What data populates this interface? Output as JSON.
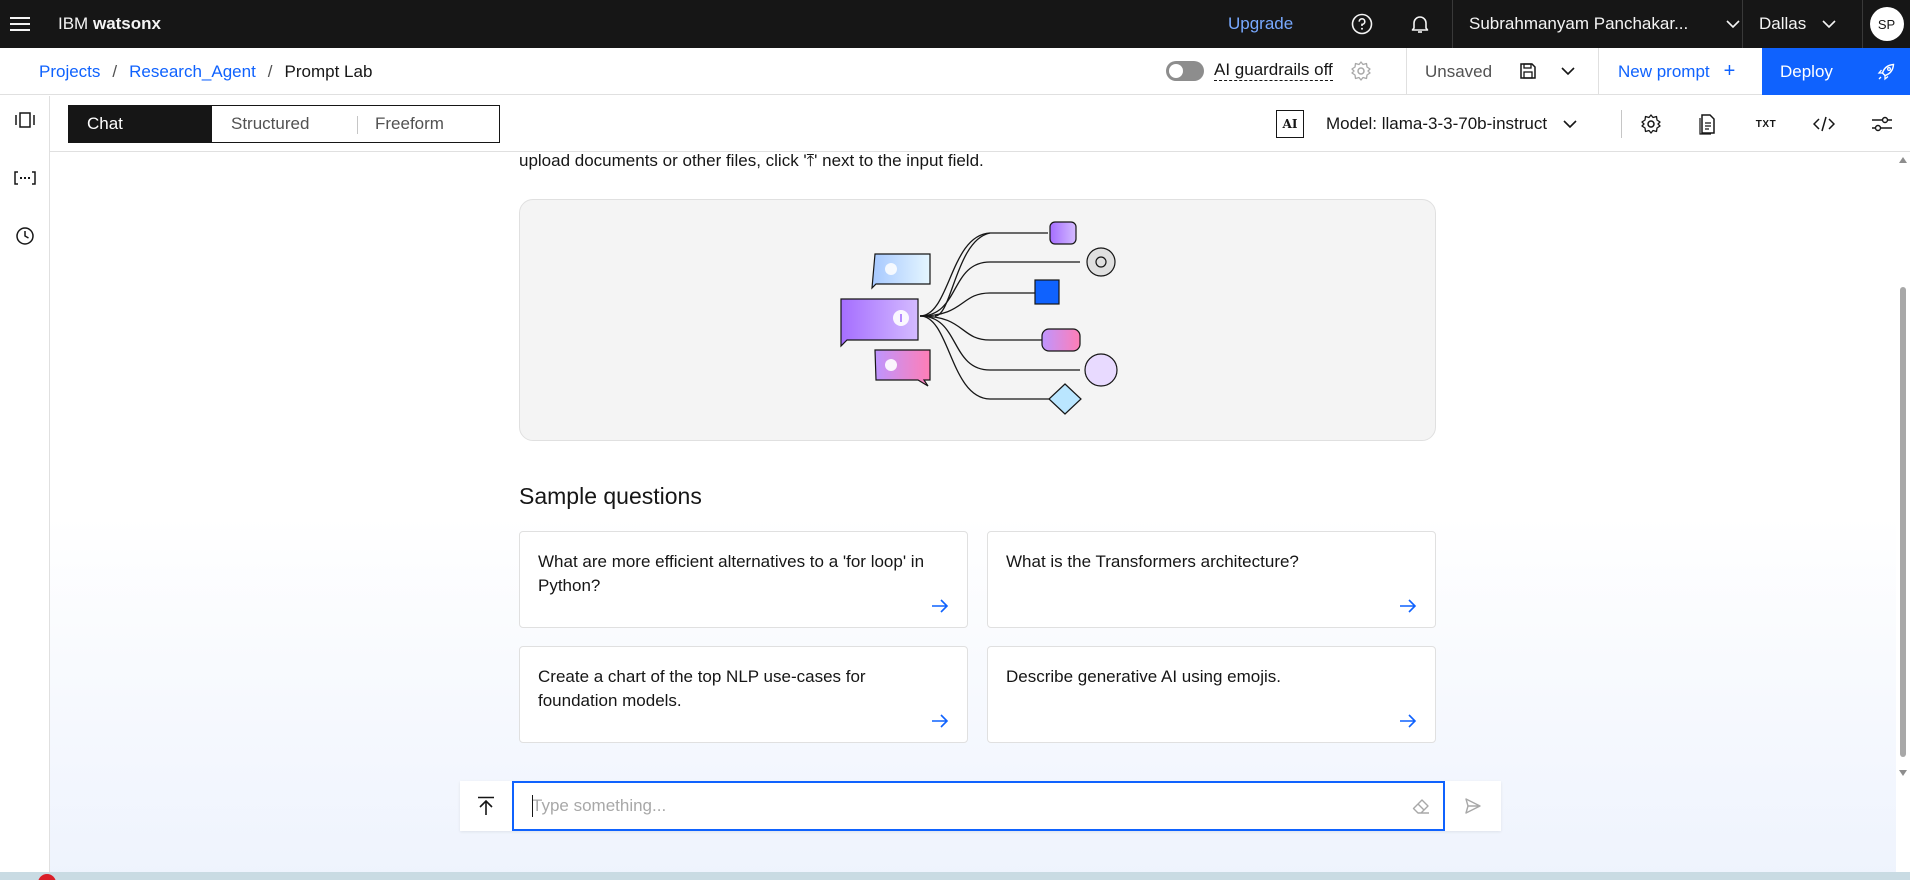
{
  "topbar": {
    "brand_prefix": "IBM",
    "brand_product": "watsonx",
    "upgrade": "Upgrade",
    "user_name": "Subrahmanyam Panchakar...",
    "region": "Dallas",
    "avatar_initials": "SP"
  },
  "breadcrumb": {
    "items": [
      "Projects",
      "Research_Agent",
      "Prompt Lab"
    ],
    "separator": "/"
  },
  "header_actions": {
    "guardrails_label": "AI guardrails off",
    "guardrails_on": false,
    "save_status": "Unsaved",
    "new_prompt": "New prompt",
    "deploy": "Deploy"
  },
  "modes": {
    "tabs": [
      "Chat",
      "Structured",
      "Freeform"
    ],
    "active": "Chat"
  },
  "model": {
    "badge": "AI",
    "label": "Model: llama-3-3-70b-instruct"
  },
  "toolbar_icons": [
    "settings-icon",
    "document-icon",
    "txt-format-icon",
    "code-icon",
    "sliders-icon"
  ],
  "rail_icons": [
    "compare-icon",
    "variables-icon",
    "history-icon"
  ],
  "main": {
    "intro_fragment": "upload documents or other files, click '⤒' next to the input field.",
    "sample_title": "Sample questions",
    "samples": [
      "What are more efficient alternatives to a 'for loop' in Python?",
      "What is the Transformers architecture?",
      "Create a chart of the top NLP use-cases for foundation models.",
      "Describe generative AI using emojis."
    ]
  },
  "composer": {
    "placeholder": "Type something...",
    "value": ""
  },
  "colors": {
    "accent": "#0f62fe",
    "topbar_bg": "#161616",
    "link": "#0f62fe",
    "upgrade_link": "#78a9ff"
  }
}
